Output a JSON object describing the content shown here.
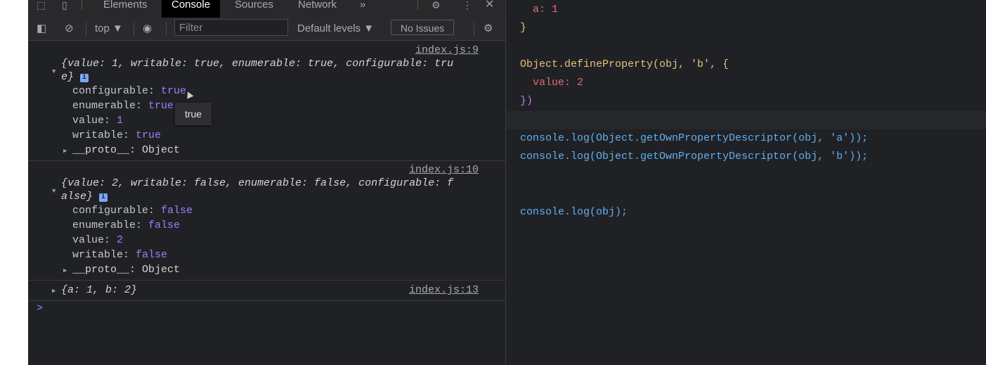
{
  "devtools": {
    "tabs": [
      "Elements",
      "Console",
      "Sources",
      "Network",
      "»"
    ],
    "active_tab": "Console",
    "toolbar": {
      "context": "top ▼",
      "filter_placeholder": "Filter",
      "levels": "Default levels ▼",
      "issues": "No Issues"
    },
    "entries": [
      {
        "source": "index.js:9",
        "summary_line1": "{value: 1, writable: true, enumerable: true, configurable: tru",
        "summary_line2": "e}",
        "props": [
          {
            "key": "configurable",
            "value": "true"
          },
          {
            "key": "enumerable",
            "value": "true"
          },
          {
            "key": "value",
            "value": "1"
          },
          {
            "key": "writable",
            "value": "true"
          }
        ],
        "proto": "__proto__: Object"
      },
      {
        "source": "index.js:10",
        "summary_line1": "{value: 2, writable: false, enumerable: false, configurable: f",
        "summary_line2": "alse}",
        "props": [
          {
            "key": "configurable",
            "value": "false"
          },
          {
            "key": "enumerable",
            "value": "false"
          },
          {
            "key": "value",
            "value": "2"
          },
          {
            "key": "writable",
            "value": "false"
          }
        ],
        "proto": "__proto__: Object"
      },
      {
        "source": "index.js:13",
        "summary_line1": "{a: 1, b: 2}"
      }
    ],
    "tooltip": "true",
    "prompt": ">"
  },
  "editor": {
    "lines": [
      {
        "text": "  a: 1",
        "kind": "prop"
      },
      {
        "text": "}",
        "kind": "brace"
      },
      {
        "text": "Object.defineProperty(obj, 'b', {",
        "kind": "code"
      },
      {
        "text": "  value: 2",
        "kind": "prop"
      },
      {
        "text": "})",
        "kind": "brace"
      },
      {
        "text": "console.log(Object.getOwnPropertyDescriptor(obj, 'a'));",
        "kind": "code"
      },
      {
        "text": "console.log(Object.getOwnPropertyDescriptor(obj, 'b'));",
        "kind": "code"
      },
      {
        "text": "console.log(obj);",
        "kind": "code"
      }
    ]
  },
  "colors": {
    "console_bg": "#202124",
    "editor_bg": "#1f2125",
    "accent": "#9980ff",
    "link": "#6c9ef8"
  }
}
